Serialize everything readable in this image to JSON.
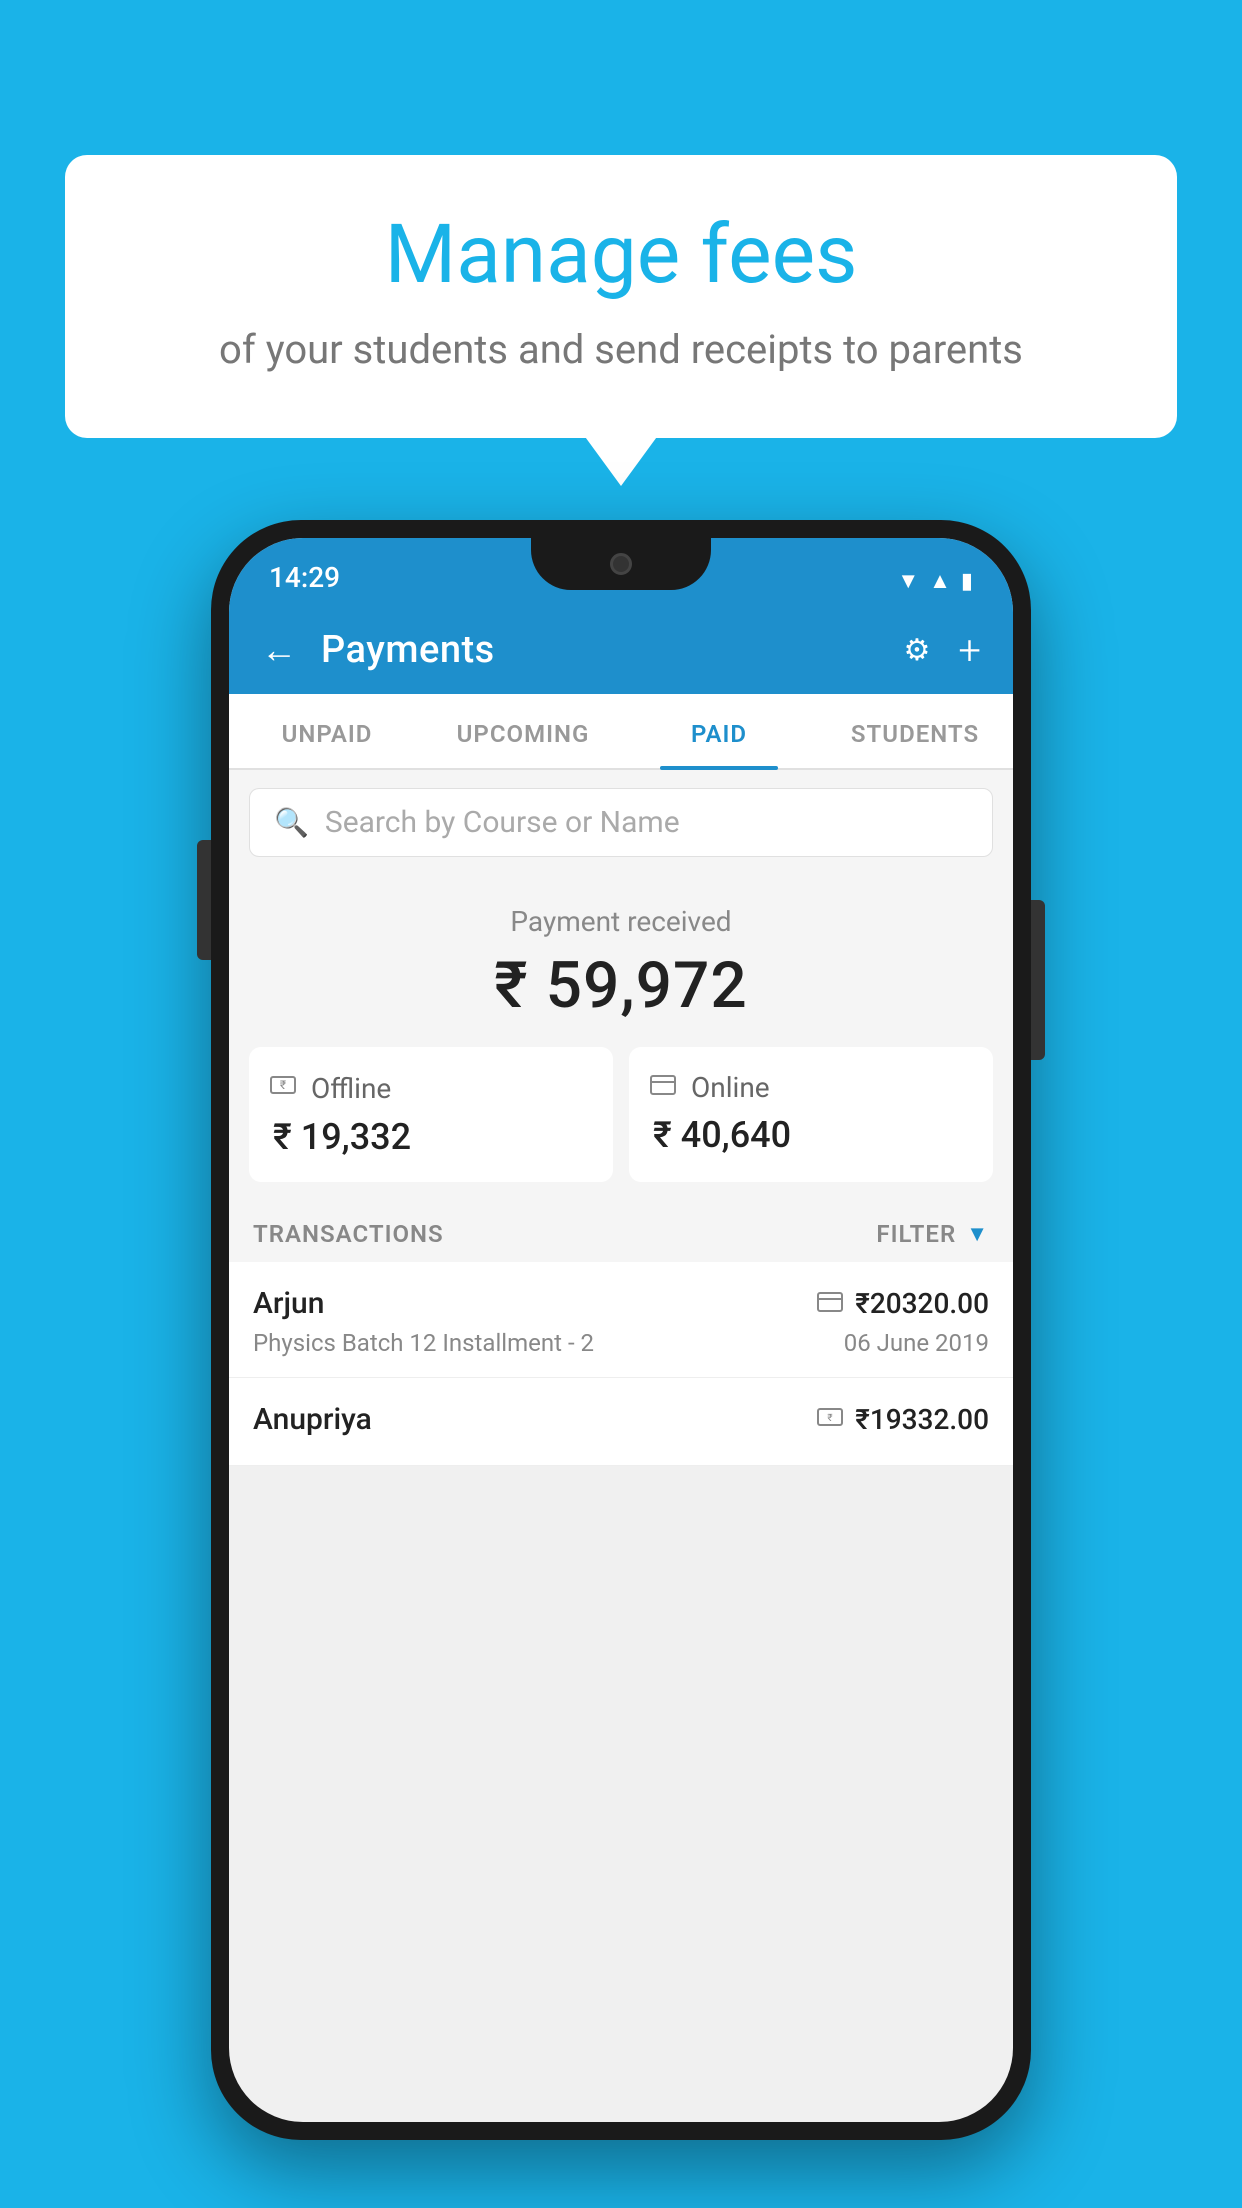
{
  "page": {
    "background_color": "#1ab3e8"
  },
  "speech_bubble": {
    "title": "Manage fees",
    "subtitle": "of your students and send receipts to parents"
  },
  "status_bar": {
    "time": "14:29",
    "wifi_icon": "▼",
    "signal_icon": "▲",
    "battery_icon": "▮"
  },
  "top_nav": {
    "back_label": "←",
    "title": "Payments",
    "settings_icon": "⚙",
    "add_icon": "+"
  },
  "tabs": [
    {
      "label": "UNPAID",
      "active": false
    },
    {
      "label": "UPCOMING",
      "active": false
    },
    {
      "label": "PAID",
      "active": true
    },
    {
      "label": "STUDENTS",
      "active": false
    }
  ],
  "search": {
    "placeholder": "Search by Course or Name"
  },
  "payment_received": {
    "label": "Payment received",
    "amount": "₹ 59,972"
  },
  "payment_cards": [
    {
      "icon": "💳",
      "label": "Offline",
      "amount": "₹ 19,332"
    },
    {
      "icon": "💳",
      "label": "Online",
      "amount": "₹ 40,640"
    }
  ],
  "transactions_section": {
    "label": "TRANSACTIONS",
    "filter_label": "FILTER"
  },
  "transactions": [
    {
      "name": "Arjun",
      "course": "Physics Batch 12 Installment - 2",
      "amount": "₹20320.00",
      "date": "06 June 2019",
      "payment_type": "online"
    },
    {
      "name": "Anupriya",
      "course": "",
      "amount": "₹19332.00",
      "date": "",
      "payment_type": "offline"
    }
  ]
}
